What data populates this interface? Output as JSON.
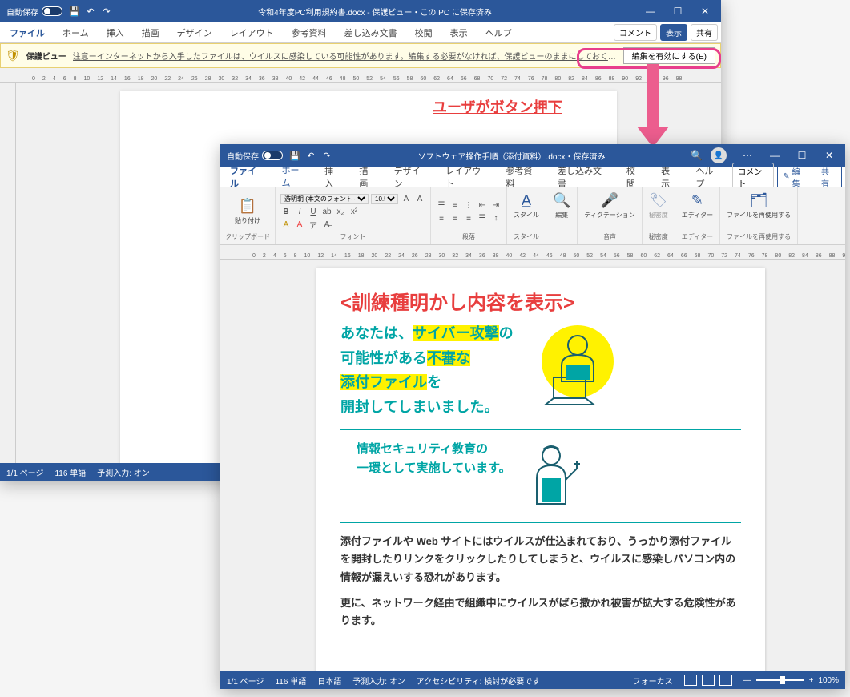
{
  "bg": {
    "titlebar": {
      "autosave": "自動保存",
      "title": "令和4年度PC利用規約書.docx - 保護ビュー・この PC に保存済み"
    },
    "menus": [
      "ファイル",
      "ホーム",
      "挿入",
      "描画",
      "デザイン",
      "レイアウト",
      "参考資料",
      "差し込み文書",
      "校閲",
      "表示",
      "ヘルプ"
    ],
    "protected": {
      "name": "保護ビュー",
      "msg": "注意ーインターネットから入手したファイルは、ウイルスに感染している可能性があります。編集する必要がなければ、保護ビューのままにしておくことをお勧めします。",
      "button": "編集を有効にする(E)"
    },
    "status": {
      "page": "1/1 ページ",
      "words": "116 単語",
      "ime": "予測入力: オン"
    },
    "right_pills": {
      "comment": "コメント",
      "view": "表示",
      "share": "共有"
    }
  },
  "fg": {
    "titlebar": {
      "autosave": "自動保存",
      "title": "ソフトウェア操作手順（添付資料）.docx・保存済み"
    },
    "menus": [
      "ファイル",
      "ホーム",
      "挿入",
      "描画",
      "デザイン",
      "レイアウト",
      "参考資料",
      "差し込み文書",
      "校閲",
      "表示",
      "ヘルプ"
    ],
    "right_pills": {
      "comment": "コメント",
      "edit": "編集",
      "share": "共有"
    },
    "ribbon": {
      "clipboard": {
        "paste": "貼り付け",
        "label": "クリップボード"
      },
      "font": {
        "name": "游明朝 (本文のフォント - 日本",
        "size": "10.5",
        "label": "フォント"
      },
      "paragraph": {
        "label": "段落"
      },
      "styles": {
        "btn": "スタイル",
        "label": "スタイル"
      },
      "editing": {
        "btn": "編集",
        "label": ""
      },
      "dictation": {
        "btn": "ディクテーション",
        "label": "音声"
      },
      "sensitivity": {
        "btn": "秘密度",
        "label": "秘密度"
      },
      "editor": {
        "btn": "エディター",
        "label": "エディター"
      },
      "reuse": {
        "btn": "ファイルを再使用する",
        "label": "ファイルを再使用する"
      }
    },
    "status": {
      "page": "1/1 ページ",
      "words": "116 単語",
      "lang": "日本語",
      "ime": "予測入力: オン",
      "a11y": "アクセシビリティ: 検討が必要です",
      "focus": "フォーカス",
      "zoom": "100%"
    }
  },
  "annotation": "ユーザがボタン押下",
  "doc": {
    "title": "<訓練種明かし内容を表示>",
    "line1a": "あなたは、",
    "line1b": "サイバー攻撃",
    "line1c": "の",
    "line2a": "可能性がある",
    "line2b": "不審な",
    "line3a": "添付ファイル",
    "line3b": "を",
    "line4": "開封してしまいました。",
    "sub1": "情報セキュリティ教育の",
    "sub2": "一環として実施しています。",
    "body1": "添付ファイルや Web サイトにはウイルスが仕込まれており、うっかり添付ファイルを開封したりリンクをクリックしたりしてしまうと、ウイルスに感染しパソコン内の情報が漏えいする恐れがあります。",
    "body2": "更に、ネットワーク経由で組織中にウイルスがばら撒かれ被害が拡大する危険性があります。"
  }
}
